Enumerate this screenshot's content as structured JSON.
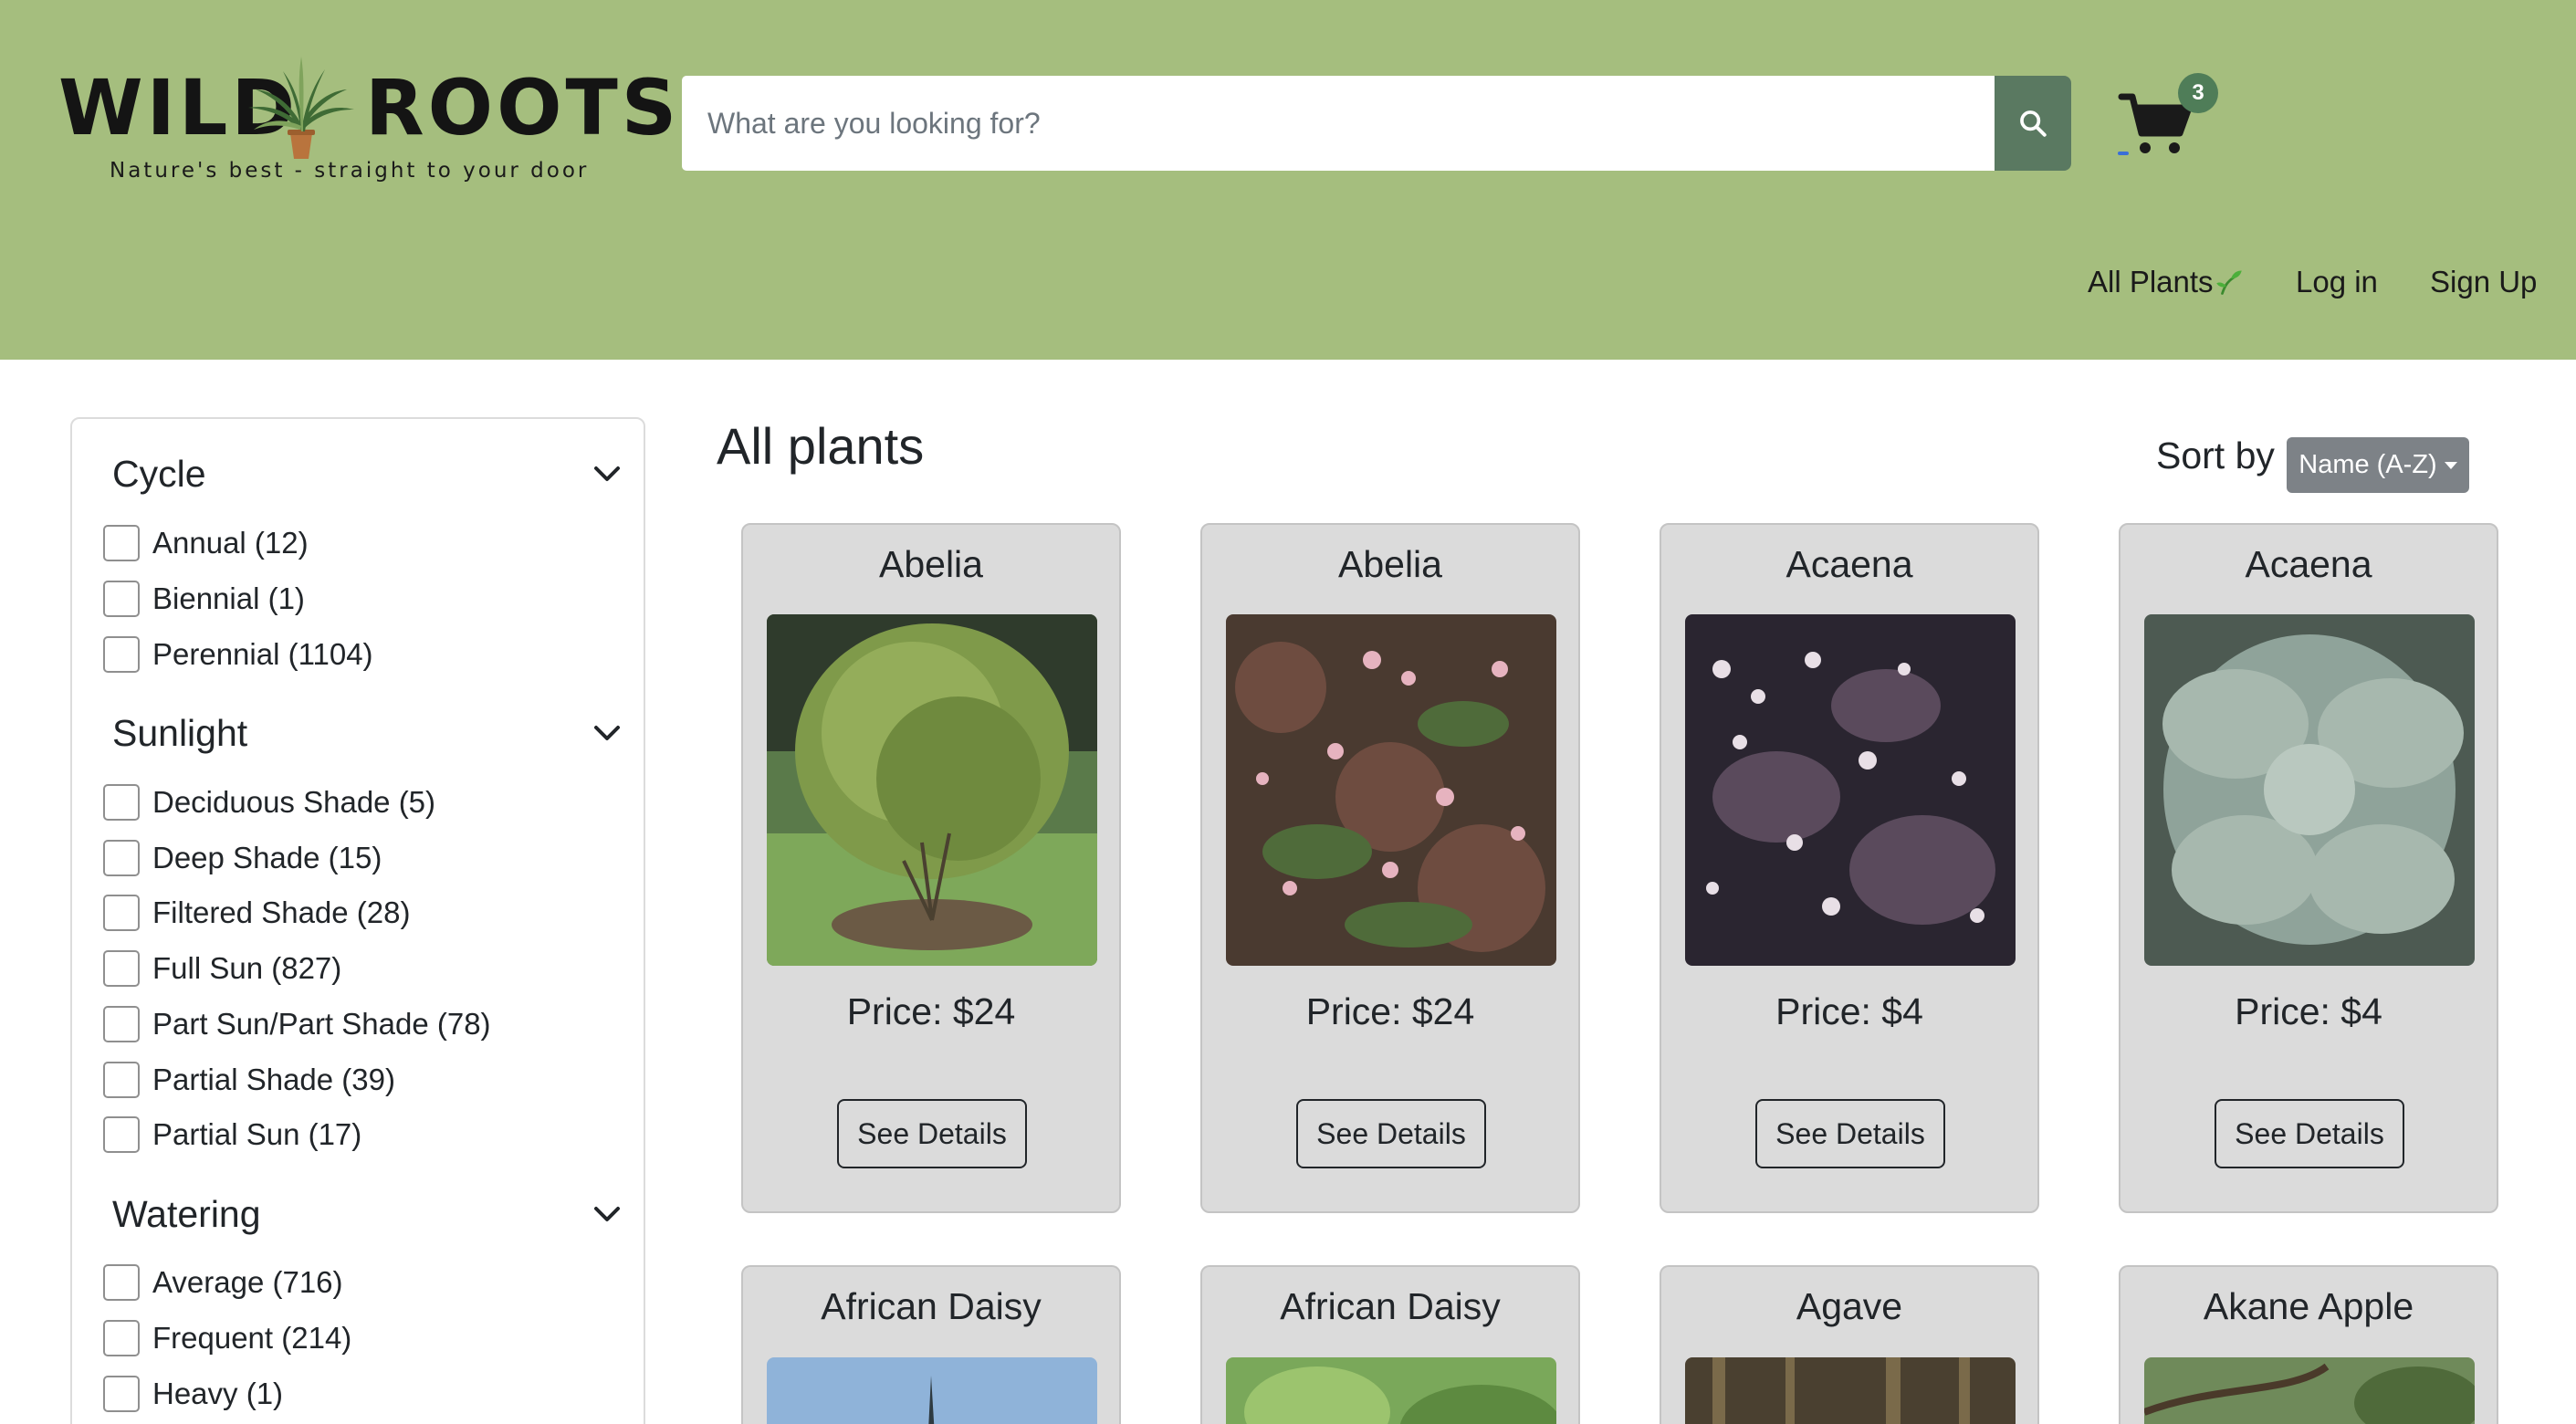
{
  "header": {
    "logo": {
      "word_left": "WILD",
      "word_right": "ROOTS",
      "tagline": "Nature's best - straight to your door"
    },
    "search": {
      "placeholder": "What are you looking for?",
      "value": ""
    },
    "cart": {
      "count": "3",
      "icon": "cart-icon"
    },
    "nav": [
      {
        "label": "All Plants",
        "icon": "sprout-icon"
      },
      {
        "label": "Log in"
      },
      {
        "label": "Sign Up"
      }
    ]
  },
  "sidebar": {
    "sections": [
      {
        "title": "Cycle",
        "options": [
          "Annual (12)",
          "Biennial (1)",
          "Perennial (1104)"
        ]
      },
      {
        "title": "Sunlight",
        "options": [
          "Deciduous Shade (5)",
          "Deep Shade (15)",
          "Filtered Shade (28)",
          "Full Sun (827)",
          "Part Sun/Part Shade (78)",
          "Partial Shade (39)",
          "Partial Sun (17)"
        ]
      },
      {
        "title": "Watering",
        "options": [
          "Average (716)",
          "Frequent (214)",
          "Heavy (1)"
        ]
      }
    ]
  },
  "main": {
    "title": "All plants",
    "sort": {
      "label": "Sort by",
      "selected": "Name (A-Z)"
    },
    "products": [
      {
        "name": "Abelia",
        "price": "Price: $24",
        "button": "See Details"
      },
      {
        "name": "Abelia",
        "price": "Price: $24",
        "button": "See Details"
      },
      {
        "name": "Acaena",
        "price": "Price: $4",
        "button": "See Details"
      },
      {
        "name": "Acaena",
        "price": "Price: $4",
        "button": "See Details"
      },
      {
        "name": "African Daisy"
      },
      {
        "name": "African Daisy"
      },
      {
        "name": "Agave"
      },
      {
        "name": "Akane Apple"
      }
    ]
  },
  "colors": {
    "header_bg": "#a5be7e",
    "search_button": "#5a7961",
    "cart_badge": "#4f7d58",
    "card_bg": "#dbdbdb",
    "sort_button": "#7d8287"
  }
}
